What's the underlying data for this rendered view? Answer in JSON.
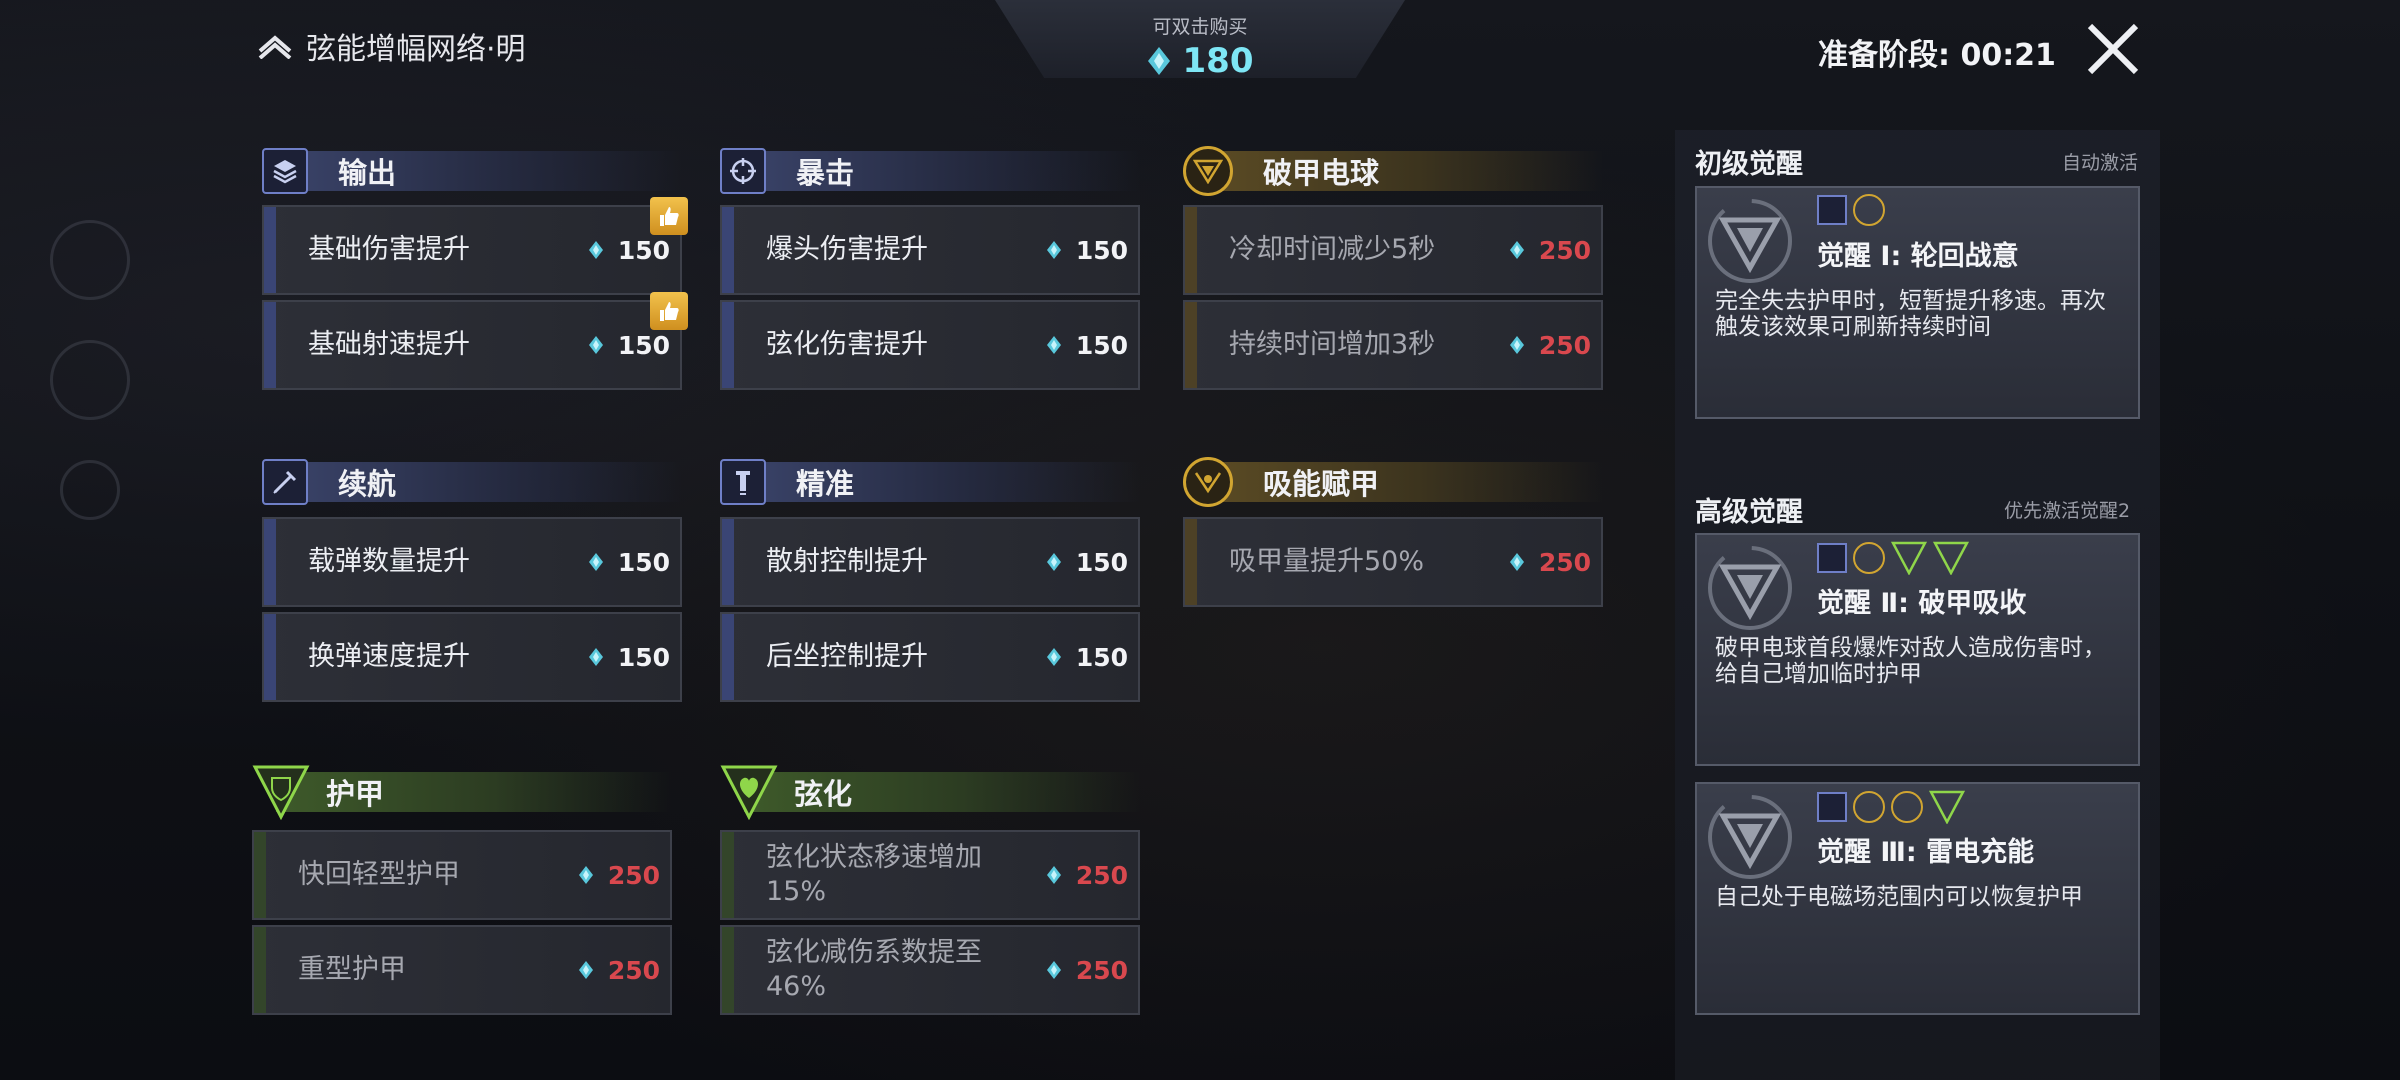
{
  "header": {
    "title": "弦能增幅网络·明",
    "currency_label": "可双击购买",
    "currency_value": "180",
    "phase": "准备阶段: 00:21"
  },
  "categories": [
    {
      "label": "输出",
      "theme": "blue",
      "icon": "cube-layers-icon",
      "items": [
        {
          "name": "基础伤害提升",
          "price": "150",
          "recommended": true
        },
        {
          "name": "基础射速提升",
          "price": "150",
          "recommended": true
        }
      ]
    },
    {
      "label": "暴击",
      "theme": "blue",
      "icon": "crosshair-icon",
      "items": [
        {
          "name": "爆头伤害提升",
          "price": "150"
        },
        {
          "name": "弦化伤害提升",
          "price": "150"
        }
      ]
    },
    {
      "label": "破甲电球",
      "theme": "gold",
      "icon": "armor-break-orb-icon",
      "items": [
        {
          "name": "冷却时间减少5秒",
          "price": "250"
        },
        {
          "name": "持续时间增加3秒",
          "price": "250"
        }
      ]
    },
    {
      "label": "续航",
      "theme": "blue",
      "icon": "syringe-icon",
      "items": [
        {
          "name": "载弹数量提升",
          "price": "150"
        },
        {
          "name": "换弹速度提升",
          "price": "150"
        }
      ]
    },
    {
      "label": "精准",
      "theme": "blue",
      "icon": "bullet-icon",
      "items": [
        {
          "name": "散射控制提升",
          "price": "150"
        },
        {
          "name": "后坐控制提升",
          "price": "150"
        }
      ]
    },
    {
      "label": "吸能赋甲",
      "theme": "gold",
      "icon": "energy-absorb-icon",
      "items": [
        {
          "name": "吸甲量提升50%",
          "price": "250"
        }
      ]
    },
    {
      "label": "护甲",
      "theme": "green",
      "icon": "shield-icon",
      "items": [
        {
          "name": "快回轻型护甲",
          "price": "250"
        },
        {
          "name": "重型护甲",
          "price": "250"
        }
      ]
    },
    {
      "label": "弦化",
      "theme": "green",
      "icon": "heart-shield-icon",
      "items": [
        {
          "name": "弦化状态移速增加15%",
          "price": "250"
        },
        {
          "name": "弦化减伤系数提至46%",
          "price": "250"
        }
      ]
    }
  ],
  "awakening": {
    "basic_title": "初级觉醒",
    "basic_sub": "自动激活",
    "advanced_title": "高级觉醒",
    "advanced_sub": "优先激活觉醒2",
    "cards": [
      {
        "title": "觉醒 Ⅰ: 轮回战意",
        "desc": "完全失去护甲时，短暂提升移速。再次触发该效果可刷新持续时间",
        "slots": [
          "square",
          "circle"
        ]
      },
      {
        "title": "觉醒 Ⅱ: 破甲吸收",
        "desc": "破甲电球首段爆炸对敌人造成伤害时，给自己增加临时护甲",
        "slots": [
          "square",
          "circle",
          "triangle",
          "triangle"
        ]
      },
      {
        "title": "觉醒 Ⅲ: 雷电充能",
        "desc": "自己处于电磁场范围内可以恢复护甲",
        "slots": [
          "square",
          "circle",
          "circle",
          "triangle"
        ]
      }
    ]
  },
  "colors": {
    "accent_cyan": "#7ee6f5",
    "price_red": "#d9484e",
    "blue_frame": "#6f7fc7",
    "gold_frame": "#d1a531",
    "green_frame": "#8fd64a"
  }
}
